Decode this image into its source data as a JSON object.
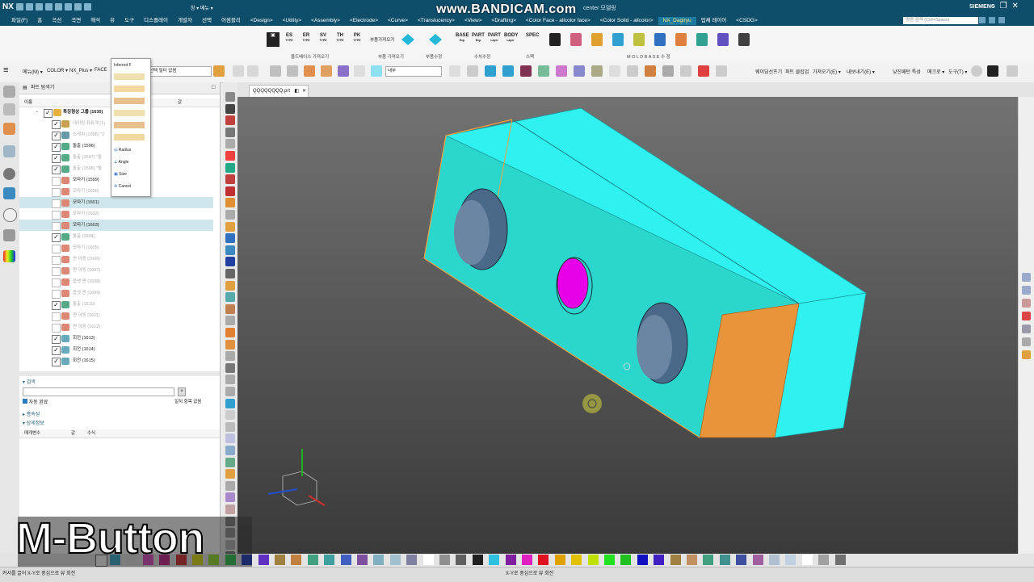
{
  "title_bar": {
    "app_logo": "NX",
    "window_title": "center 모델링",
    "brand": "SIEMENS",
    "window_controls": [
      "–",
      "❐",
      "✕"
    ],
    "menu_label": "창 ▾  메뉴 ▾"
  },
  "watermark": {
    "text": "www.BANDICAM.com"
  },
  "menu_bar": {
    "items": [
      "파일(F)",
      "홈",
      "곡선",
      "곡면",
      "해석",
      "뷰",
      "도구",
      "디스플레이",
      "개발자",
      "선택",
      "어셈블리",
      "<Design>",
      "<Utility>",
      "<Assembly>",
      "<Electrode>",
      "<Curve>",
      "<Translucency>",
      "<View>",
      "<Drafting>",
      "<Color Face - allcolor face>",
      "<Color Solid - allcolor>",
      "NX_Dagiryu",
      "업체 레이어",
      "<CSDG>"
    ],
    "active_item": "NX_Dagiryu",
    "search_placeholder": "명령 검색 (Ctrl+Space)"
  },
  "ribbon": {
    "buttons": [
      {
        "label": "ES",
        "sub": "TYPE"
      },
      {
        "label": "ER",
        "sub": "TYPE"
      },
      {
        "label": "SV",
        "sub": "TYPE"
      },
      {
        "label": "TH",
        "sub": "TYPE"
      },
      {
        "label": "PK",
        "sub": "TYPE"
      }
    ],
    "small_buttons": [
      {
        "label": "BASE",
        "sub": "Exp"
      },
      {
        "label": "PART",
        "sub": "Exp"
      },
      {
        "label": "PART",
        "sub": "Layer"
      },
      {
        "label": "BODY",
        "sub": "Layer"
      },
      {
        "label": "SPEC",
        "sub": ""
      }
    ],
    "loader_label": "부품가져오기",
    "groups": [
      "몰드베이스 가져오기",
      "부품 가져오기",
      "부품수정",
      "수치수정",
      "스펙",
      "M O L D B A S E 수 정"
    ]
  },
  "toolbar2": {
    "menu_label": "메뉴(M) ▾",
    "color_label": "COLOR ▾",
    "nxplus_label": "NX_Plus ▾",
    "face_label": "FACE",
    "filter_value": "선택 필터 없음",
    "inferred_label": "Inferred F",
    "dropdown_value": "내부",
    "right_items": [
      "웨이딩선프기",
      "파트 클립업",
      "가져오기(E) ▾",
      "내보내기(E) ▾",
      "낮진패턴 특성",
      "매크로 ▾",
      "도구(T) ▾"
    ]
  },
  "nav_panel": {
    "title": "파트 탐색기",
    "col_name": "이름",
    "col_value": "값",
    "root_label": "특징형상 그룹 (1630)",
    "rows": [
      {
        "label": "데이텀 좌표계 (1)",
        "checked": true,
        "dim": true,
        "selected": false,
        "color": "#c8a050"
      },
      {
        "label": "스케치 (1595) \"2",
        "checked": true,
        "dim": true,
        "selected": false,
        "color": "#69a"
      },
      {
        "label": "돌출 (1596)",
        "checked": true,
        "dim": false,
        "selected": false,
        "color": "#5a8"
      },
      {
        "label": "돌출 (1597) \"돌",
        "checked": true,
        "dim": true,
        "selected": false,
        "color": "#5a8"
      },
      {
        "label": "돌출 (1598) \"돌",
        "checked": true,
        "dim": true,
        "selected": false,
        "color": "#5a8"
      },
      {
        "label": "모따기 (1599)",
        "checked": false,
        "dim": false,
        "selected": false,
        "color": "#d87"
      },
      {
        "label": "모따기 (1600)",
        "checked": false,
        "dim": true,
        "selected": false,
        "color": "#d87"
      },
      {
        "label": "모따기 (1601)",
        "checked": false,
        "dim": false,
        "selected": true,
        "color": "#d87"
      },
      {
        "label": "모따기 (1602)",
        "checked": false,
        "dim": true,
        "selected": false,
        "color": "#d87"
      },
      {
        "label": "모따기 (1603)",
        "checked": false,
        "dim": false,
        "selected": true,
        "color": "#d87"
      },
      {
        "label": "돌출 (1604)",
        "checked": true,
        "dim": true,
        "selected": false,
        "color": "#5a8"
      },
      {
        "label": "모따기 (1605)",
        "checked": false,
        "dim": true,
        "selected": false,
        "color": "#d87"
      },
      {
        "label": "면 이동 (1606)",
        "checked": false,
        "dim": true,
        "selected": false,
        "color": "#d87"
      },
      {
        "label": "면 이동 (1607)",
        "checked": false,
        "dim": true,
        "selected": false,
        "color": "#d87"
      },
      {
        "label": "옵셋 면 (1608)",
        "checked": false,
        "dim": true,
        "selected": false,
        "color": "#d87"
      },
      {
        "label": "옵셋 면 (1609)",
        "checked": false,
        "dim": true,
        "selected": false,
        "color": "#d87"
      },
      {
        "label": "돌출 (1610)",
        "checked": true,
        "dim": true,
        "selected": false,
        "color": "#5a8"
      },
      {
        "label": "면 이동 (1611)",
        "checked": false,
        "dim": true,
        "selected": false,
        "color": "#d87"
      },
      {
        "label": "면 이동 (1612)",
        "checked": false,
        "dim": true,
        "selected": false,
        "color": "#d87"
      },
      {
        "label": "회전 (1613)",
        "checked": true,
        "dim": false,
        "selected": false,
        "color": "#6ab"
      },
      {
        "label": "회전 (1614)",
        "checked": true,
        "dim": false,
        "selected": false,
        "color": "#6ab"
      },
      {
        "label": "회전 (1615)",
        "checked": true,
        "dim": false,
        "selected": false,
        "color": "#6ab"
      }
    ],
    "search_title": "검색",
    "auto_complete_label": "자동 완료",
    "match_label": "일치 항목 없음",
    "dependency_title": "종속성",
    "details_title": "상세정보",
    "details_cols": [
      "매개변수",
      "값",
      "수식"
    ]
  },
  "selection_popup": {
    "title": "Inferred F",
    "options": [
      "Radius",
      "Angle",
      "Size",
      "Cancel"
    ]
  },
  "tab": {
    "label": "QQQQQQQQ.prt"
  },
  "caption": {
    "text": "M-Button"
  },
  "status_bar": {
    "left_text": "커서를 끌어 X-Y로 중심으로 뷰 회전",
    "center_text": "X-Y로 중심으로 뷰 회전"
  },
  "colors": {
    "title_bg": "#0e4e6b",
    "part_cyan": "#2ff1ef",
    "part_orange": "#e8943a",
    "hole_magenta": "#e800e8",
    "hole_blue": "#4a6888"
  },
  "palette_colors": [
    "#2aa6cf",
    "#e0e0e0",
    "#e040c0",
    "#c01080",
    "#d02020",
    "#e0e000",
    "#90e020",
    "#20c040",
    "#1030c0",
    "#6030c0",
    "#a08040",
    "#c08040",
    "#40a080",
    "#40a0a0",
    "#4060c0",
    "#8050a0",
    "#80b0c0",
    "#a0c0d0",
    "#8080a0",
    "#ffffff",
    "#909090",
    "#606060",
    "#202020",
    "#30c0e0",
    "#8020a0",
    "#e020c0",
    "#e01020",
    "#e0a000",
    "#e0c000",
    "#c0e000",
    "#20e020",
    "#20c020",
    "#1010c0",
    "#4020c0",
    "#a08040",
    "#c09060",
    "#40a080",
    "#409090",
    "#4050a0",
    "#a060a0",
    "#b0c0d0",
    "#c0d0e0",
    "#ffffff",
    "#a0a0a0",
    "#707070"
  ]
}
